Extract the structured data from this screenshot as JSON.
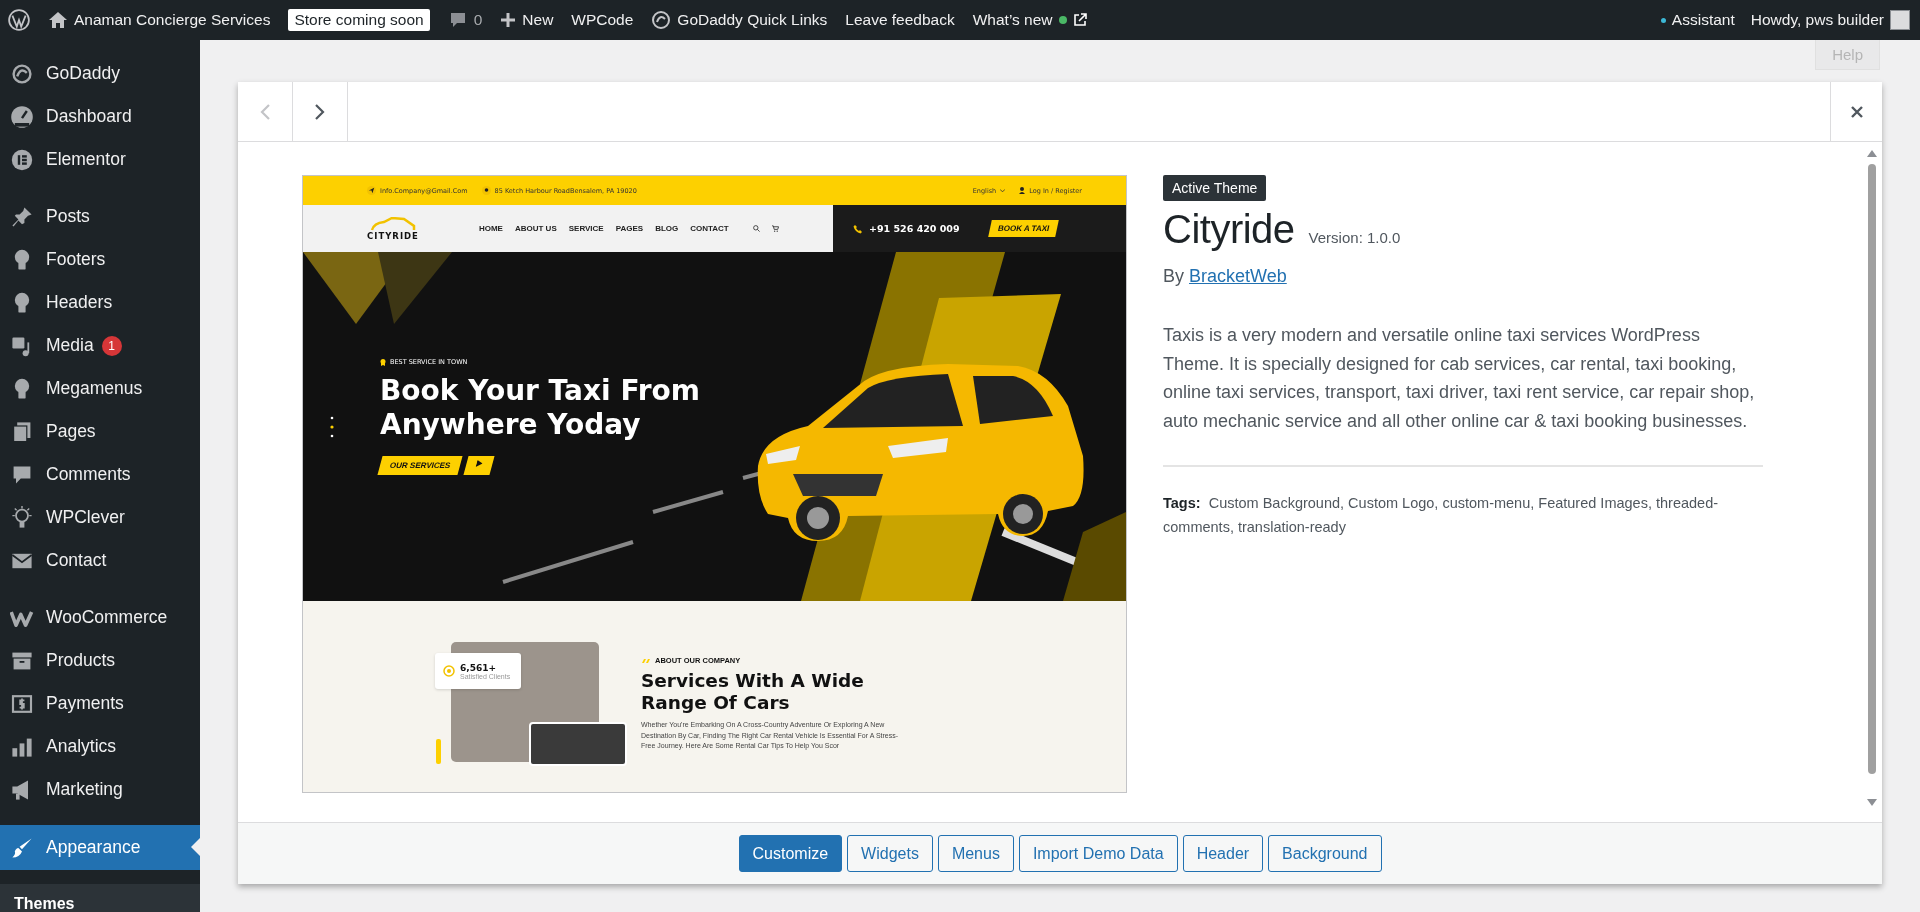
{
  "admin_bar": {
    "site_name": "Anaman Concierge Services",
    "store_badge": "Store coming soon",
    "comments_count": "0",
    "new_label": "New",
    "links": [
      {
        "label": "WPCode",
        "kind": "text"
      },
      {
        "label": "GoDaddy Quick Links",
        "kind": "icon"
      },
      {
        "label": "Leave feedback",
        "kind": "text"
      },
      {
        "label": "What’s new",
        "kind": "news"
      }
    ],
    "assistant": "Assistant",
    "greeting": "Howdy, pws builder"
  },
  "sidebar": {
    "sections": [
      {
        "items": [
          {
            "label": "GoDaddy",
            "selected": false
          },
          {
            "label": "Dashboard",
            "selected": false
          },
          {
            "label": "Elementor",
            "selected": false
          }
        ]
      },
      {
        "items": [
          {
            "label": "Posts",
            "selected": false
          },
          {
            "label": "Footers",
            "selected": false
          },
          {
            "label": "Headers",
            "selected": false
          },
          {
            "label": "Media",
            "selected": false,
            "badge": "1"
          },
          {
            "label": "Megamenus",
            "selected": false
          },
          {
            "label": "Pages",
            "selected": false
          },
          {
            "label": "Comments",
            "selected": false
          },
          {
            "label": "WPClever",
            "selected": false
          },
          {
            "label": "Contact",
            "selected": false
          }
        ]
      },
      {
        "items": [
          {
            "label": "WooCommerce",
            "selected": false
          },
          {
            "label": "Products",
            "selected": false
          },
          {
            "label": "Payments",
            "selected": false
          },
          {
            "label": "Analytics",
            "selected": false
          },
          {
            "label": "Marketing",
            "selected": false
          }
        ]
      },
      {
        "items": [
          {
            "label": "Appearance",
            "selected": true
          }
        ]
      }
    ],
    "submenu": [
      {
        "label": "Themes",
        "selected": true
      }
    ]
  },
  "background": {
    "help_tab": "Help"
  },
  "modal": {
    "previous_disabled": true,
    "next_disabled": false,
    "preview": {
      "email": "Info.Company@Gmail.Com",
      "address": "85 Ketch Harbour RoadBensalem, PA 19020",
      "language": "English",
      "login": "Log In / Register",
      "logo": "CITYRIDE",
      "nav": [
        "HOME",
        "ABOUT US",
        "SERVICE",
        "PAGES",
        "BLOG",
        "CONTACT"
      ],
      "phone": "+91 526 420 009",
      "book_button": "BOOK A TAXI",
      "hero_tag": "BEST SERVICE IN TOWN",
      "hero_title": [
        "Book Your Taxi From",
        "Anywhere Yoday"
      ],
      "services_button": "OUR SERVICES",
      "stat_value": "6,561+",
      "stat_label": "Satisfied Clients",
      "about_tag": "ABOUT OUR COMPANY",
      "about_title": [
        "Services With A Wide",
        "Range Of Cars"
      ],
      "about_text": "Whether You're Embarking On A Cross-Country Adventure Or Exploring A New Destination By Car, Finding The Right Car Rental Vehicle Is Essential For A Stress-Free Journey. Here Are Some Rental Car Tips To Help You Scor"
    },
    "theme": {
      "active_badge": "Active Theme",
      "name": "Cityride",
      "version": "Version: 1.0.0",
      "author_prefix": "By",
      "author": "BracketWeb",
      "description": "Taxis is a very modern and versatile online taxi services WordPress Theme. It is specially designed for cab services, car rental, taxi booking, online taxi services, transport, taxi driver, taxi rent service, car repair shop, auto mechanic service and all other online car & taxi booking businesses.",
      "tags_label": "Tags:",
      "tags": "Custom Background, Custom Logo, custom-menu, Featured Images, threaded-comments, translation-ready"
    },
    "buttons": [
      {
        "label": "Customize",
        "primary": true
      },
      {
        "label": "Widgets",
        "primary": false
      },
      {
        "label": "Menus",
        "primary": false
      },
      {
        "label": "Import Demo Data",
        "primary": false
      },
      {
        "label": "Header",
        "primary": false
      },
      {
        "label": "Background",
        "primary": false
      }
    ]
  }
}
